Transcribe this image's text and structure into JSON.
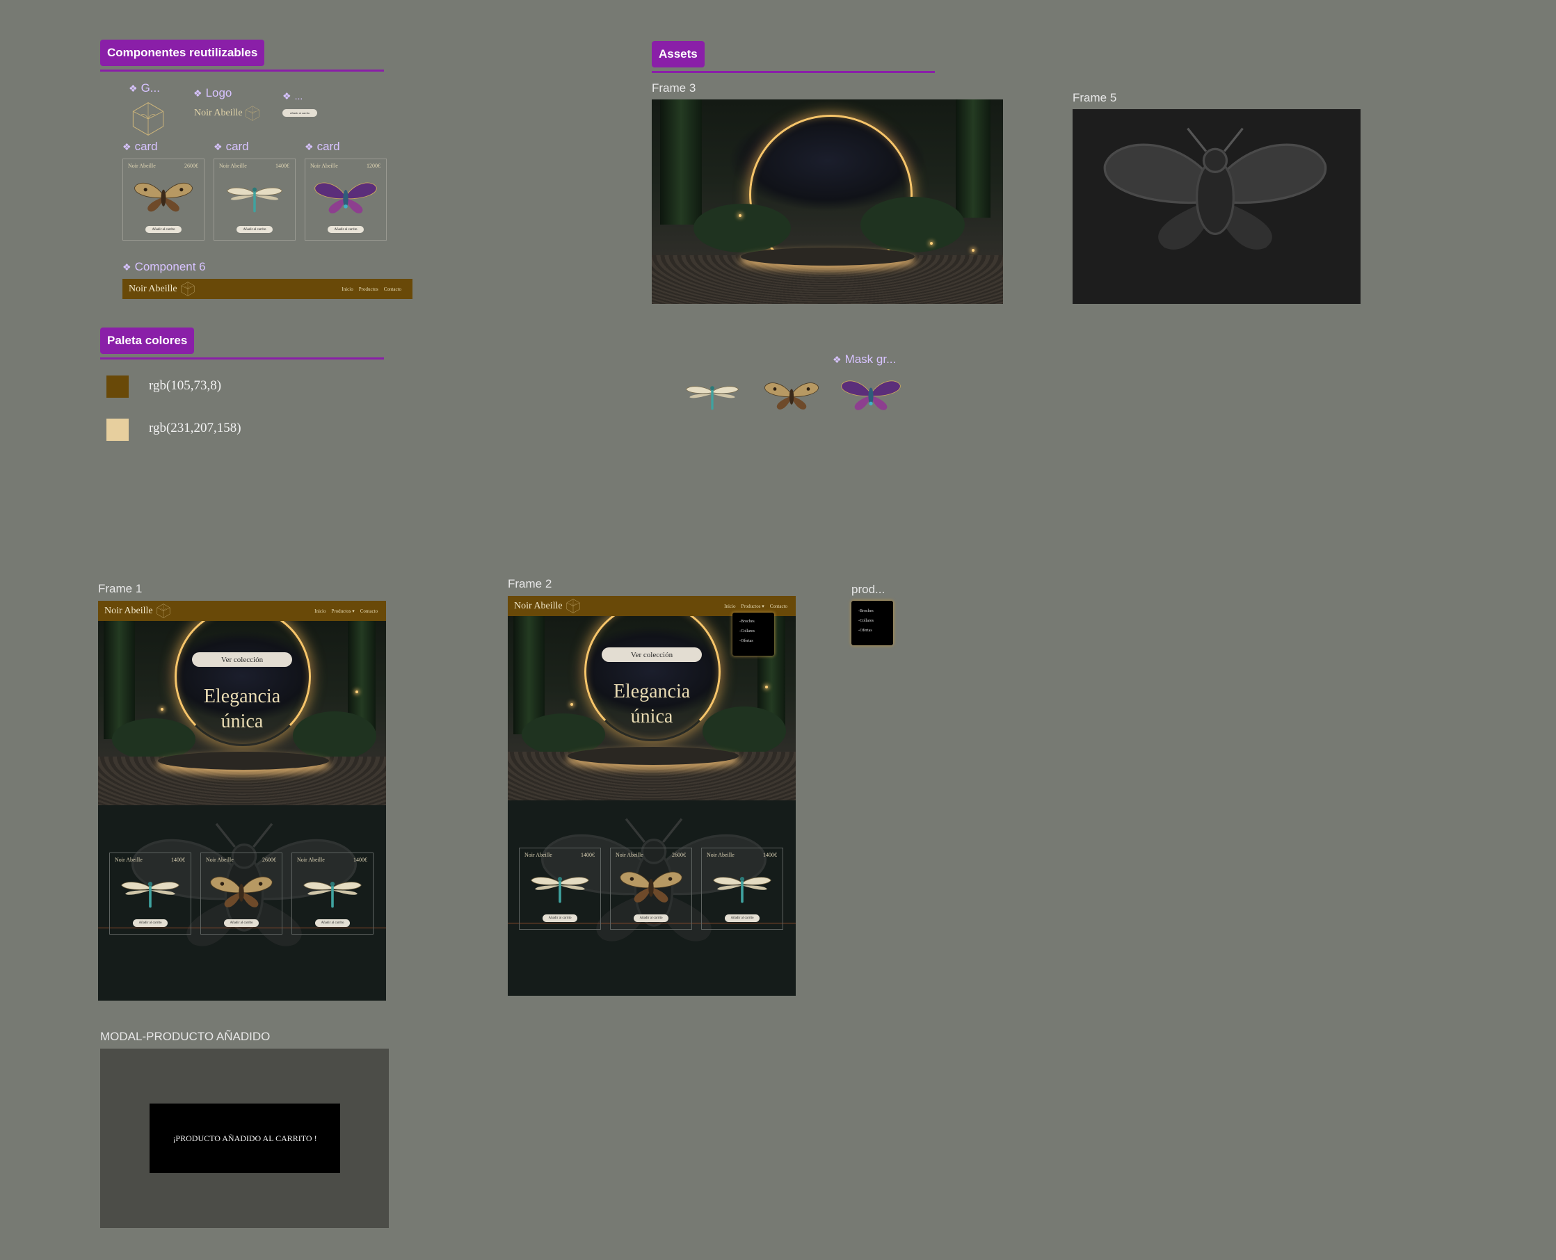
{
  "canvas": {
    "background": "#777a73"
  },
  "components_section": {
    "badge": "Componentes reutilizables",
    "labels": {
      "graphic": "G...",
      "logo": "Logo",
      "button": "...",
      "card1": "card",
      "card2": "card",
      "card3": "card",
      "component6": "Component 6"
    },
    "logo_text": "Noir Abeille",
    "button_text": "Añadir al carrito",
    "cards": [
      {
        "brand": "Noir Abeille",
        "price": "2600€",
        "button": "Añadir al carrito"
      },
      {
        "brand": "Noir Abeille",
        "price": "1400€",
        "button": "Añadir al carrito"
      },
      {
        "brand": "Noir Abeille",
        "price": "1200€",
        "button": "Añadir al carrito"
      }
    ],
    "navbar": {
      "brand": "Noir Abeille",
      "links": [
        "Inicio",
        "Productos",
        "Contacto"
      ]
    }
  },
  "palette_section": {
    "badge": "Paleta colores",
    "colors": [
      {
        "hex": "#694908",
        "label": "rgb(105,73,8)"
      },
      {
        "hex": "#e7cf9e",
        "label": "rgb(231,207,158)"
      }
    ]
  },
  "assets_section": {
    "badge": "Assets",
    "frame3_label": "Frame 3",
    "frame5_label": "Frame 5",
    "mask_group_label": "Mask gr..."
  },
  "frame1": {
    "label": "Frame 1",
    "nav": {
      "brand": "Noir Abeille",
      "links": [
        "Inicio",
        "Productos ▾",
        "Contacto"
      ]
    },
    "cta": "Ver colección",
    "title_line1": "Elegancia",
    "title_line2": "única",
    "cards": [
      {
        "brand": "Noir Abeille",
        "price": "1400€",
        "button": "Añadir al carrito"
      },
      {
        "brand": "Noir Abeille",
        "price": "2600€",
        "button": "Añadir al carrito"
      },
      {
        "brand": "Noir Abeille",
        "price": "1400€",
        "button": "Añadir al carrito"
      }
    ]
  },
  "frame2": {
    "label": "Frame 2",
    "nav": {
      "brand": "Noir Abeille",
      "links": [
        "Inicio",
        "Productos ▾",
        "Contacto"
      ]
    },
    "dropdown": [
      "-Broches",
      "-Collares",
      "-Ofertas"
    ],
    "cta": "Ver colección",
    "title_line1": "Elegancia",
    "title_line2": "única",
    "cards": [
      {
        "brand": "Noir Abeille",
        "price": "1400€",
        "button": "Añadir al carrito"
      },
      {
        "brand": "Noir Abeille",
        "price": "2600€",
        "button": "Añadir al carrito"
      },
      {
        "brand": "Noir Abeille",
        "price": "1400€",
        "button": "Añadir al carrito"
      }
    ]
  },
  "prod_component": {
    "label": "prod...",
    "items": [
      "-Broches",
      "-Collares",
      "-Ofertas"
    ]
  },
  "modal": {
    "label": "MODAL-PRODUCTO AÑADIDO",
    "message": "¡PRODUCTO AÑADIDO AL CARRITO !"
  }
}
